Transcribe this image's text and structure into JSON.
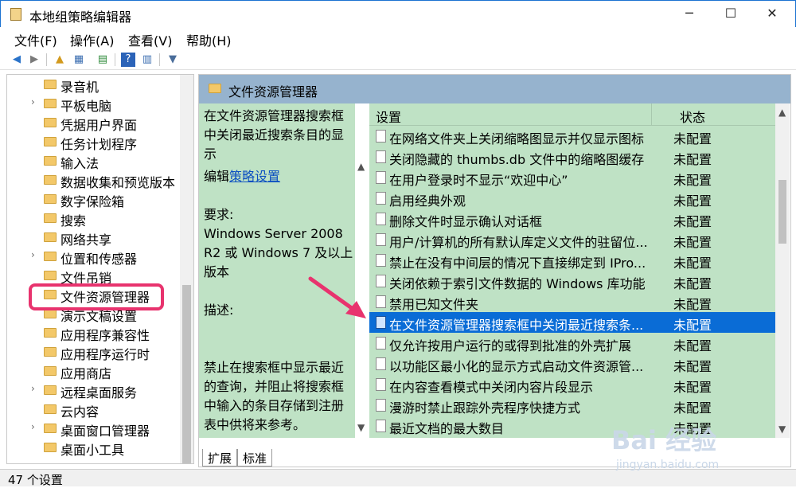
{
  "window": {
    "title": "本地组策略编辑器",
    "min": "─",
    "max": "☐",
    "close": "✕"
  },
  "menu": [
    "文件(F)",
    "操作(A)",
    "查看(V)",
    "帮助(H)"
  ],
  "tree": [
    {
      "label": "录音机",
      "arrow": ""
    },
    {
      "label": "平板电脑",
      "arrow": "›"
    },
    {
      "label": "凭据用户界面",
      "arrow": ""
    },
    {
      "label": "任务计划程序",
      "arrow": ""
    },
    {
      "label": "输入法",
      "arrow": ""
    },
    {
      "label": "数据收集和预览版本",
      "arrow": ""
    },
    {
      "label": "数字保险箱",
      "arrow": ""
    },
    {
      "label": "搜索",
      "arrow": ""
    },
    {
      "label": "网络共享",
      "arrow": ""
    },
    {
      "label": "位置和传感器",
      "arrow": "›"
    },
    {
      "label": "文件吊销",
      "arrow": ""
    },
    {
      "label": "文件资源管理器",
      "arrow": ""
    },
    {
      "label": "演示文稿设置",
      "arrow": ""
    },
    {
      "label": "应用程序兼容性",
      "arrow": ""
    },
    {
      "label": "应用程序运行时",
      "arrow": ""
    },
    {
      "label": "应用商店",
      "arrow": ""
    },
    {
      "label": "远程桌面服务",
      "arrow": "›"
    },
    {
      "label": "云内容",
      "arrow": ""
    },
    {
      "label": "桌面窗口管理器",
      "arrow": "›"
    },
    {
      "label": "桌面小工具",
      "arrow": ""
    }
  ],
  "panel": {
    "title": "文件资源管理器",
    "desc_title": "在文件资源管理器搜索框中关闭最近搜索条目的显示",
    "edit_prefix": "编辑",
    "edit_link": "策略设置",
    "req_label": "要求:",
    "req_text": "Windows Server 2008 R2 或 Windows 7 及以上版本",
    "desc_label": "描述:",
    "desc_text": "禁止在搜索框中显示最近的查询，并阻止将搜索框中输入的条目存储到注册表中供将来参考。"
  },
  "list": {
    "col_setting": "设置",
    "col_status": "状态",
    "rows": [
      {
        "name": "在网络文件夹上关闭缩略图显示并仅显示图标",
        "status": "未配置"
      },
      {
        "name": "关闭隐藏的 thumbs.db 文件中的缩略图缓存",
        "status": "未配置"
      },
      {
        "name": "在用户登录时不显示“欢迎中心”",
        "status": "未配置"
      },
      {
        "name": "启用经典外观",
        "status": "未配置"
      },
      {
        "name": "删除文件时显示确认对话框",
        "status": "未配置"
      },
      {
        "name": "用户/计算机的所有默认库定义文件的驻留位...",
        "status": "未配置"
      },
      {
        "name": "禁止在没有中间层的情况下直接绑定到 IPro...",
        "status": "未配置"
      },
      {
        "name": "关闭依赖于索引文件数据的 Windows 库功能",
        "status": "未配置"
      },
      {
        "name": "禁用已知文件夹",
        "status": "未配置"
      },
      {
        "name": "在文件资源管理器搜索框中关闭最近搜索条...",
        "status": "未配置"
      },
      {
        "name": "仅允许按用户运行的或得到批准的外壳扩展",
        "status": "未配置"
      },
      {
        "name": "以功能区最小化的显示方式启动文件资源管...",
        "status": "未配置"
      },
      {
        "name": "在内容查看模式中关闭内容片段显示",
        "status": "未配置"
      },
      {
        "name": "漫游时禁止跟踪外壳程序快捷方式",
        "status": "未配置"
      },
      {
        "name": "最近文档的最大数目",
        "status": "未配置"
      }
    ]
  },
  "tabs": [
    "扩展",
    "标准"
  ],
  "status": "47 个设置",
  "watermark": {
    "main": "Bai 经验",
    "sub": "jingyan.baidu.com"
  },
  "colors": {
    "selected": "#0a6cd6",
    "panel_bg": "#bfe2c5",
    "header_bg": "#96b3ce",
    "highlight": "#e8336e"
  }
}
